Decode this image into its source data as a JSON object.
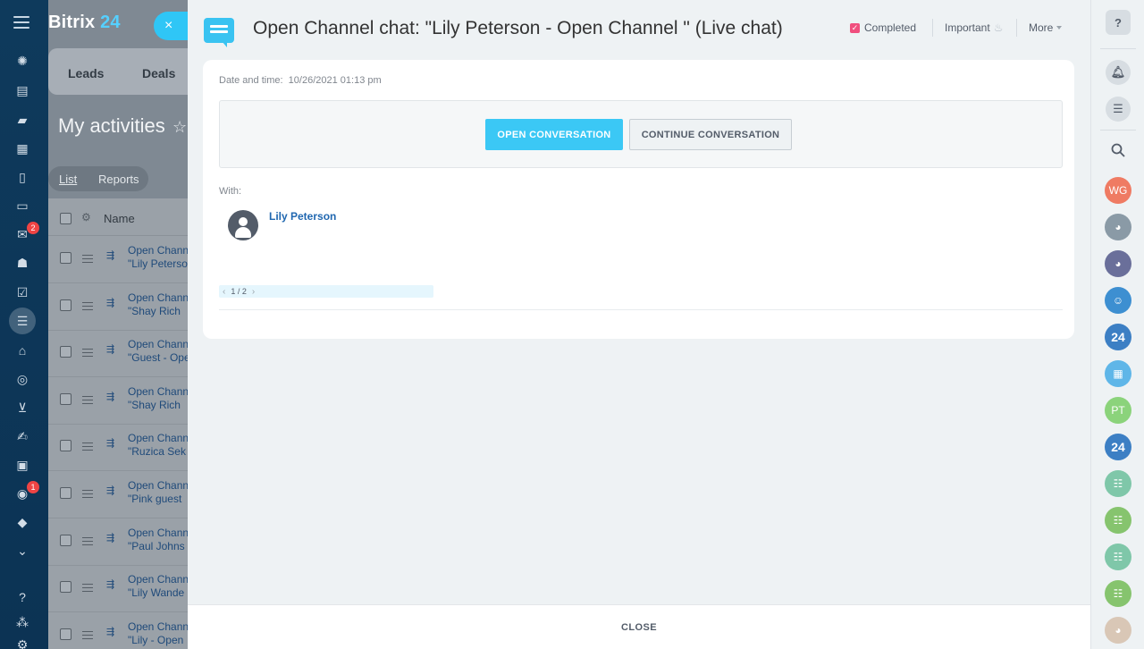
{
  "background_app": {
    "logo_text": "Bitrix",
    "logo_num": "24",
    "close_label": "×",
    "tabs": [
      "Leads",
      "Deals"
    ],
    "page_title": "My activities",
    "views": [
      "List",
      "Reports"
    ],
    "column_name": "Name",
    "rows": [
      {
        "line1": "Open Channel chat:",
        "line2": "\"Lily Peterson"
      },
      {
        "line1": "Open Channel chat:",
        "line2": "\"Shay Rich"
      },
      {
        "line1": "Open Channel chat:",
        "line2": "\"Guest - Open"
      },
      {
        "line1": "Open Channel chat:",
        "line2": "\"Shay Rich"
      },
      {
        "line1": "Open Channel chat:",
        "line2": "\"Ruzica Sek"
      },
      {
        "line1": "Open Channel chat:",
        "line2": "\"Pink guest"
      },
      {
        "line1": "Open Channel chat:",
        "line2": "\"Paul Johns"
      },
      {
        "line1": "Open Channel chat:",
        "line2": "\"Lily Wande"
      },
      {
        "line1": "Open Channel chat:",
        "line2": "\"Lily - Open"
      }
    ]
  },
  "left_sidebar": {
    "badges": {
      "mail": "2",
      "robot": "1"
    }
  },
  "slider": {
    "title": "Open Channel chat: \"Lily Peterson - Open Channel \" (Live chat)",
    "completed_label": "Completed",
    "important_label": "Important",
    "more_label": "More",
    "datetime_label": "Date and time:",
    "datetime_value": "10/26/2021 01:13 pm",
    "open_conversation": "OPEN CONVERSATION",
    "continue_conversation": "CONTINUE CONVERSATION",
    "with_label": "With:",
    "person_name": "Lily Peterson",
    "pager": "1 / 2",
    "close_label": "CLOSE"
  },
  "right_sidebar": {
    "help": "?",
    "avatars": [
      "WG",
      "PT",
      "24",
      "24"
    ]
  },
  "colors": {
    "accent": "#3bc8f5",
    "link": "#2067b0",
    "completed_check": "#f04f7e"
  }
}
